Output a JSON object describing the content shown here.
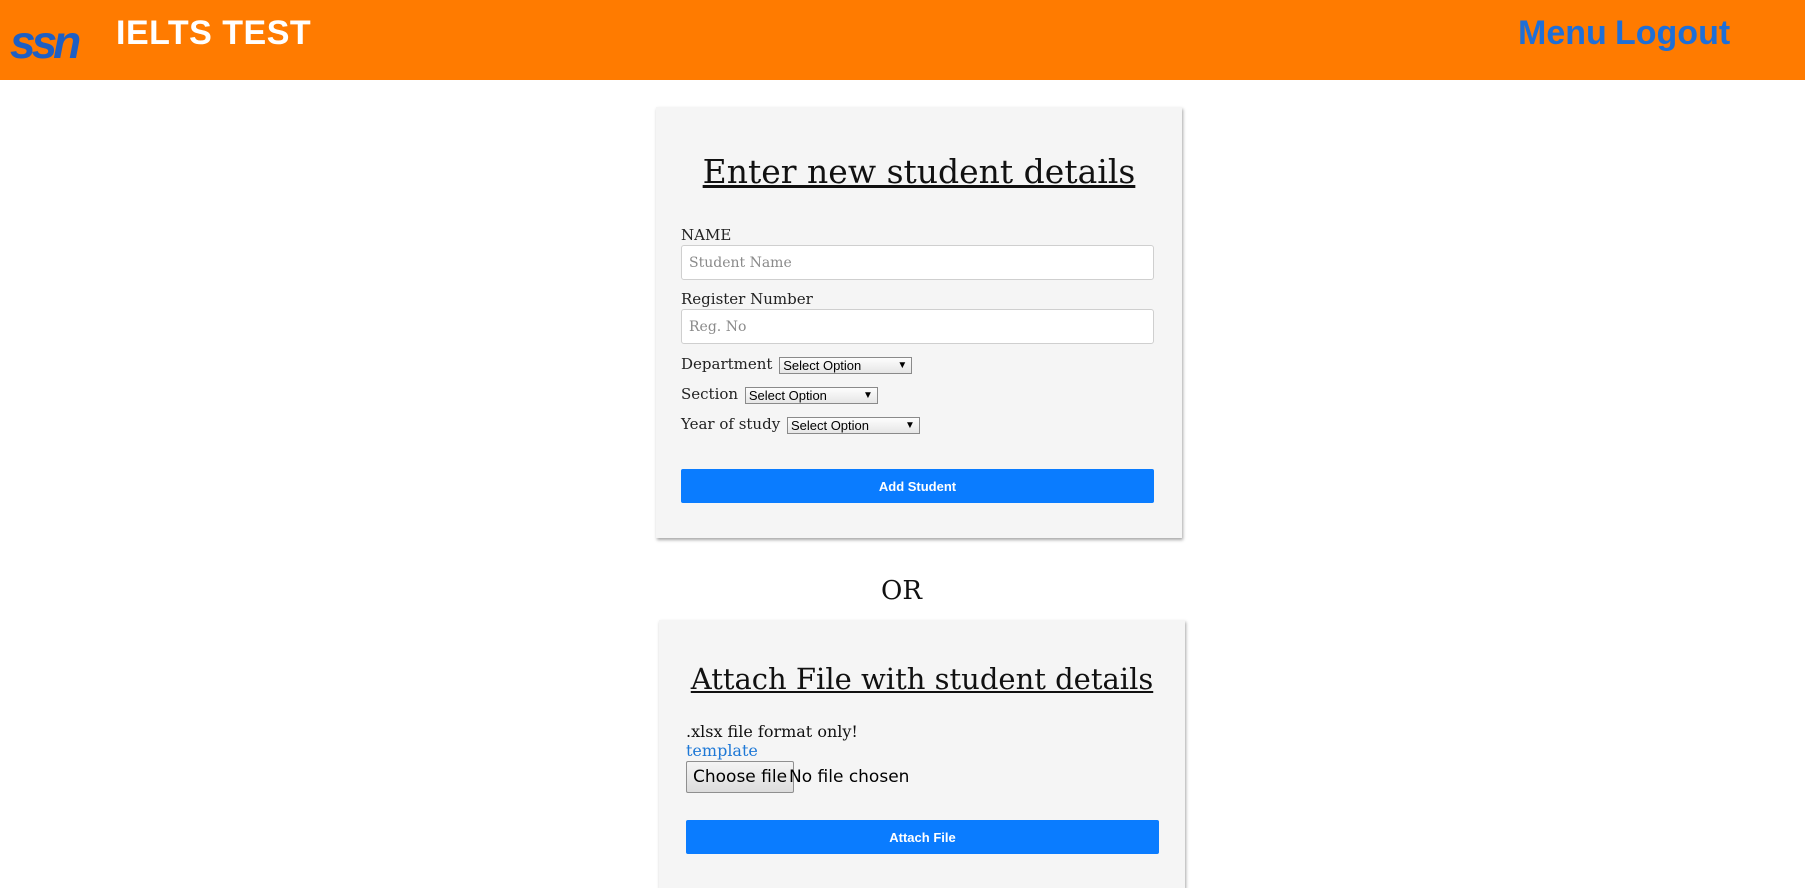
{
  "header": {
    "logo_text": "ssn",
    "brand": "IELTS TEST",
    "nav": {
      "menu": "Menu",
      "logout": "Logout"
    }
  },
  "colors": {
    "header_bg": "#ff7b00",
    "link_blue": "#1e6fd8",
    "button_blue": "#0a7cff",
    "card_bg": "#f5f5f5"
  },
  "form": {
    "title": "Enter new student details",
    "name_label": "NAME",
    "name_placeholder": "Student Name",
    "name_value": "",
    "reg_label": "Register Number",
    "reg_placeholder": "Reg. No",
    "reg_value": "",
    "department_label": "Department",
    "department_selected": "Select Option",
    "section_label": "Section",
    "section_selected": "Select Option",
    "year_label": "Year of study",
    "year_selected": "Select Option",
    "submit_label": "Add Student"
  },
  "separator": "OR",
  "attach": {
    "title": "Attach File with student details",
    "note": ".xlsx file format only!",
    "template_link": "template",
    "choose_label": "Choose file",
    "file_status": "No file chosen",
    "submit_label": "Attach File"
  }
}
